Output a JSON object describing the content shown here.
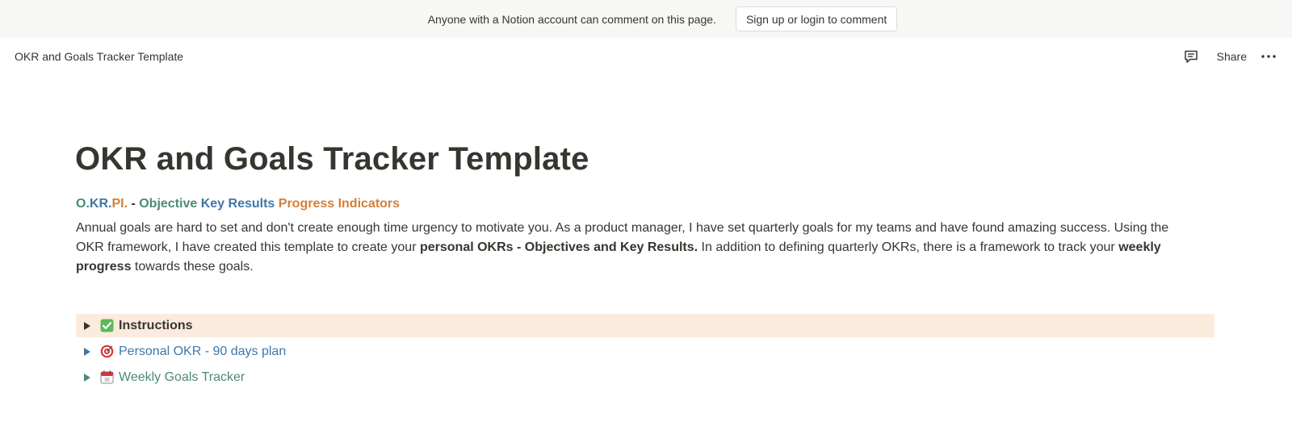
{
  "banner": {
    "text": "Anyone with a Notion account can comment on this page.",
    "button_label": "Sign up or login to comment"
  },
  "topbar": {
    "title": "OKR and Goals Tracker Template",
    "share_label": "Share",
    "icons": [
      "comment-icon",
      "more-icon"
    ]
  },
  "page": {
    "title": "OKR and Goals Tracker Template",
    "subtitle": {
      "part1": "O.",
      "part2": "KR.",
      "part3": "PI.",
      "separator": " - ",
      "word1": "Objective",
      "word2": "Key Results",
      "word3": "Progress Indicators"
    },
    "description": {
      "text1": "Annual goals are hard to set and don't create enough time urgency to motivate you. As a product manager, I have set quarterly goals for my teams and have found amazing success. Using the OKR framework, I have created this template to create your ",
      "bold1": "personal OKRs - Objectives and Key Results.",
      "text2": " In addition to defining quarterly OKRs, there is a framework to track your ",
      "bold2": "weekly progress",
      "text3": " towards these goals."
    }
  },
  "toggles": [
    {
      "label": "Instructions",
      "icon": "check-icon",
      "color": "#37352f",
      "background": "#faebdd"
    },
    {
      "label": "Personal OKR - 90 days plan",
      "icon": "target-icon",
      "color": "#3f77a8"
    },
    {
      "label": "Weekly Goals Tracker",
      "icon": "calendar-icon",
      "color": "#4d8a73"
    }
  ],
  "colors": {
    "teal": "#4d8a73",
    "blue": "#3f77a8",
    "orange": "#d37f3a",
    "highlight": "#faebdd",
    "text": "#37352f"
  }
}
